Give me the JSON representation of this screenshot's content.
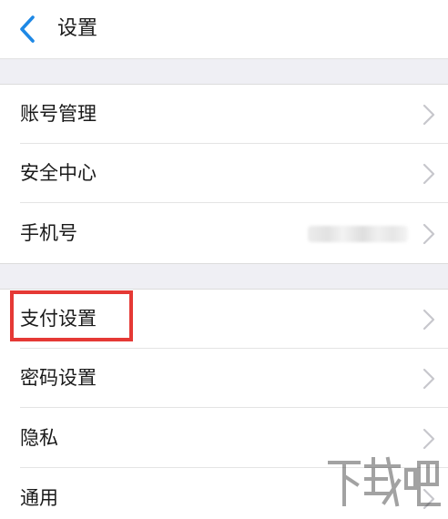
{
  "header": {
    "title": "设置",
    "back_icon": "chevron-left-icon",
    "accent_color": "#1e88e5"
  },
  "groups": [
    {
      "items": [
        {
          "label": "账号管理"
        },
        {
          "label": "安全中心"
        },
        {
          "label": "手机号"
        }
      ]
    },
    {
      "items": [
        {
          "label": "支付设置"
        },
        {
          "label": "密码设置"
        },
        {
          "label": "隐私"
        },
        {
          "label": "通用"
        }
      ]
    }
  ],
  "annotation": {
    "highlight_color": "#e53935",
    "highlighted_item": "支付设置"
  },
  "watermark": {
    "text": "下载吧"
  }
}
